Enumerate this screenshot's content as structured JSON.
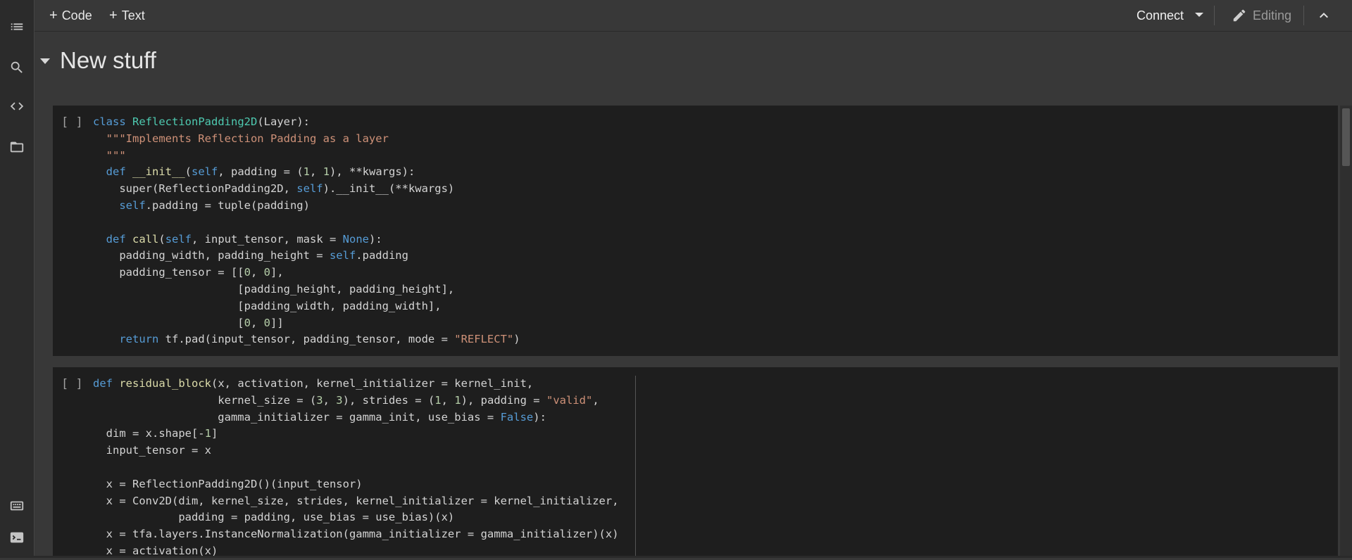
{
  "rail": {
    "icons": [
      "toc-icon",
      "search-icon",
      "code-snippets-icon",
      "folder-icon",
      "command-palette-icon",
      "terminal-icon"
    ]
  },
  "toolbar": {
    "add_code_label": "Code",
    "add_text_label": "Text",
    "connect_label": "Connect",
    "editing_label": "Editing"
  },
  "section": {
    "title": "New stuff"
  },
  "cells": [
    {
      "run_indicator": "[ ]",
      "lines": [
        "class ReflectionPadding2D(Layer):",
        "  \"\"\"Implements Reflection Padding as a layer",
        "  \"\"\"",
        "  def __init__(self, padding = (1, 1), **kwargs):",
        "    super(ReflectionPadding2D, self).__init__(**kwargs)",
        "    self.padding = tuple(padding)",
        "",
        "  def call(self, input_tensor, mask = None):",
        "    padding_width, padding_height = self.padding",
        "    padding_tensor = [[0, 0],",
        "                      [padding_height, padding_height],",
        "                      [padding_width, padding_width],",
        "                      [0, 0]]",
        "    return tf.pad(input_tensor, padding_tensor, mode = \"REFLECT\")"
      ]
    },
    {
      "run_indicator": "[ ]",
      "lines": [
        "def residual_block(x, activation, kernel_initializer = kernel_init,",
        "                   kernel_size = (3, 3), strides = (1, 1), padding = \"valid\",",
        "                   gamma_initializer = gamma_init, use_bias = False):",
        "  dim = x.shape[-1]",
        "  input_tensor = x",
        "",
        "  x = ReflectionPadding2D()(input_tensor)",
        "  x = Conv2D(dim, kernel_size, strides, kernel_initializer = kernel_initializer,",
        "             padding = padding, use_bias = use_bias)(x)",
        "  x = tfa.layers.InstanceNormalization(gamma_initializer = gamma_initializer)(x)",
        "  x = activation(x)"
      ]
    }
  ]
}
